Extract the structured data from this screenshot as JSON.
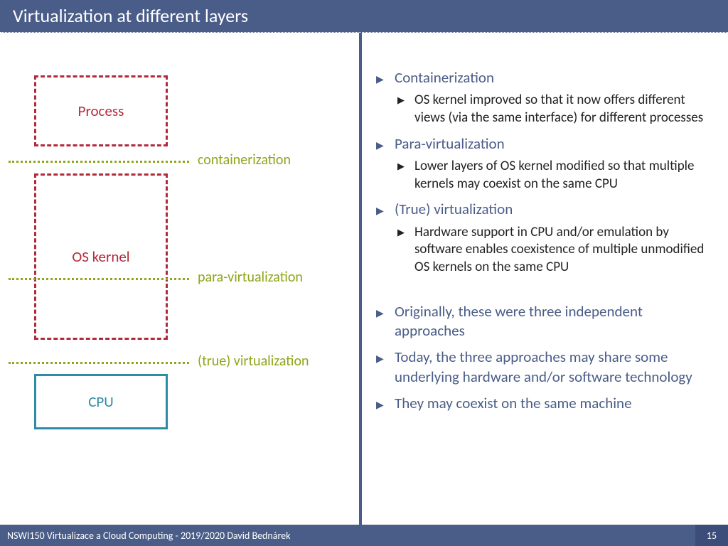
{
  "title": "Virtualization at different layers",
  "diagram": {
    "process": "Process",
    "oskernel": "OS kernel",
    "cpu": "CPU",
    "div1": "containerization",
    "div2": "para-virtualization",
    "div3": "(true) virtualization"
  },
  "bullets": {
    "b1": "Containerization",
    "b1a": "OS kernel improved so that it now offers different views (via the same interface) for different processes",
    "b2": "Para-virtualization",
    "b2a": "Lower layers of OS kernel modified so that multiple kernels may coexist on the same CPU",
    "b3": "(True) virtualization",
    "b3a": "Hardware support in CPU and/or emulation by software enables coexistence of multiple unmodified OS kernels on the same CPU",
    "b4": "Originally, these were three independent approaches",
    "b5": "Today, the three approaches may share some underlying hardware and/or software technology",
    "b6": "They may coexist on the same machine"
  },
  "footer": {
    "text": "NSWI150 Virtualizace a Cloud Computing - 2019/2020 David Bednárek",
    "page": "15"
  }
}
